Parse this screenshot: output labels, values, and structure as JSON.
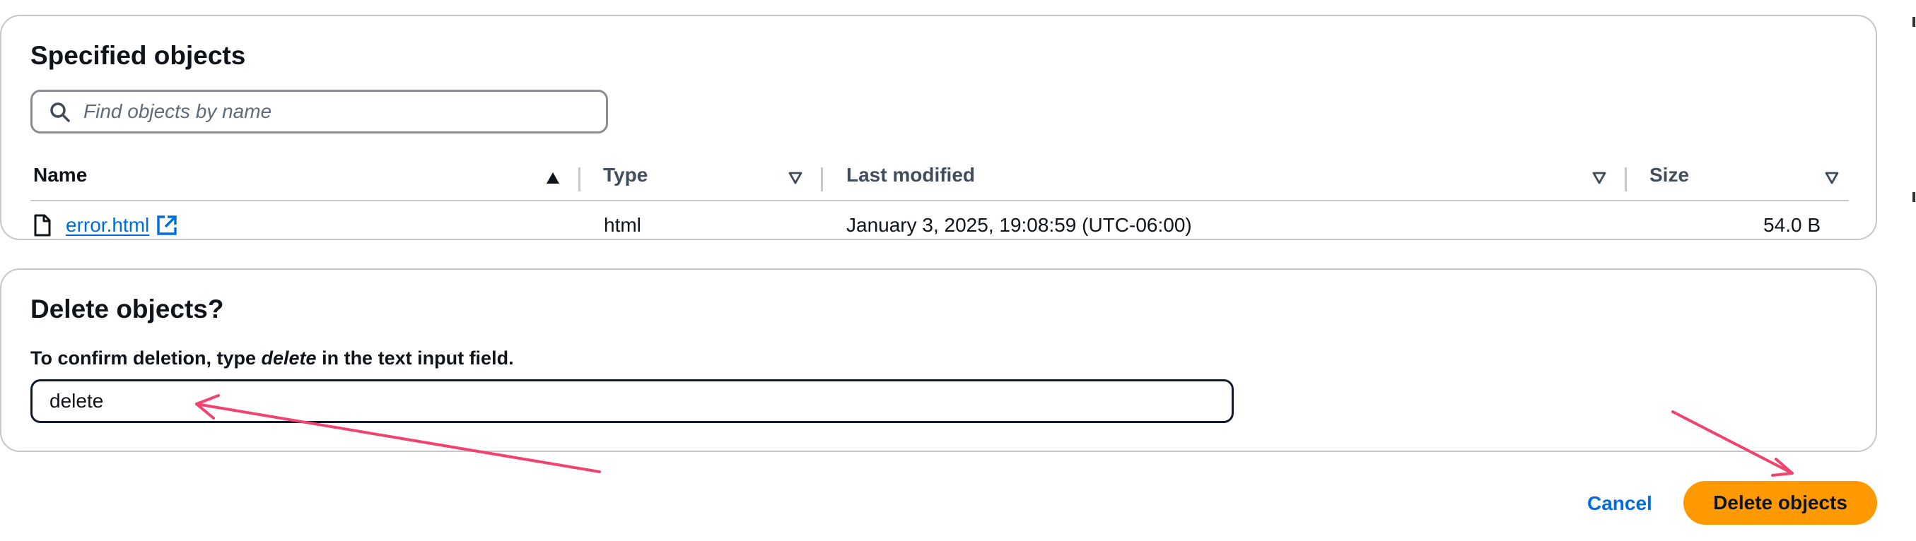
{
  "objects_panel": {
    "title": "Specified objects",
    "search": {
      "placeholder": "Find objects by name",
      "value": ""
    },
    "columns": {
      "name": "Name",
      "type": "Type",
      "last_modified": "Last modified",
      "size": "Size"
    },
    "rows": [
      {
        "name": "error.html",
        "type": "html",
        "last_modified": "January 3, 2025, 19:08:59 (UTC-06:00)",
        "size": "54.0 B"
      }
    ]
  },
  "delete_panel": {
    "title": "Delete objects?",
    "confirm_prefix": "To confirm deletion, type ",
    "confirm_keyword": "delete",
    "confirm_suffix": " in the text input field.",
    "input_value": "delete"
  },
  "actions": {
    "cancel_label": "Cancel",
    "delete_label": "Delete objects"
  },
  "colors": {
    "link": "#006ce0",
    "primary_button": "#ff9900",
    "annotation_arrow": "#f0436e"
  },
  "icons": [
    "search-icon",
    "sort-ascending-icon",
    "sort-descending-icon",
    "file-icon",
    "external-link-icon"
  ]
}
